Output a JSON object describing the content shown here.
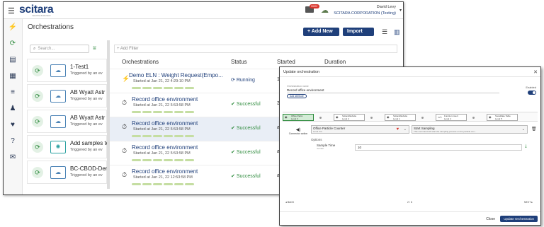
{
  "app": {
    "logo_main": "scitara",
    "tagline": "meet the dexterous!",
    "notif_count": "9999+",
    "user_name": "David Levy",
    "user_company": "SCITARA CORPORATION (Testing)"
  },
  "page": {
    "title": "Orchestrations",
    "add_new": "+ Add New",
    "import": "Import"
  },
  "left": {
    "search_placeholder": "Search...",
    "cards": [
      {
        "title": "1-Test1",
        "sub": "Triggered by an ev"
      },
      {
        "title": "AB Wyatt Astr",
        "sub": "Triggered by an ev"
      },
      {
        "title": "AB Wyatt Astr",
        "sub": "Triggered by an ev"
      },
      {
        "title": "Add samples tc",
        "sub": "Triggered by an ev"
      },
      {
        "title": "BC-CBOD-Den",
        "sub": "Triggered by an ev"
      }
    ]
  },
  "table": {
    "add_filter": "+ Add Filter",
    "headers": {
      "orchestrations": "Orchestrations",
      "status": "Status",
      "started": "Started",
      "duration": "Duration"
    },
    "rows": [
      {
        "name": "Demo ELN : Weight Request(Empo...",
        "started": "Started at Jan 21, 22 4:29:10 PM",
        "status": "Running",
        "by": "1"
      },
      {
        "name": "Record office environment",
        "started": "Started at Jan 21, 22 5:53:58 PM",
        "status": "Successful",
        "by": "3e"
      },
      {
        "name": "Record office environment",
        "started": "Started at Jan 21, 22 5:53:58 PM",
        "status": "Successful",
        "by": "ab"
      },
      {
        "name": "Record office environment",
        "started": "Started at Jan 21, 22 5:53:58 PM",
        "status": "Successful",
        "by": "ab"
      },
      {
        "name": "Record office environment",
        "started": "Started at Jan 21, 22 12:53:58 PM",
        "status": "Successful",
        "by": "ab"
      }
    ]
  },
  "dialog": {
    "title": "Update orchestration",
    "name_label": "Orchestration name",
    "name_value": "Record office environment",
    "add_attr": "Add attribute",
    "enabled": "Enabled",
    "steps": [
      {
        "t": "Office Partic.",
        "s": "Level 3"
      },
      {
        "t": "ScitaraWebsite",
        "s": "Level 2"
      },
      {
        "t": "ScitaraWebsite",
        "s": "Level 1"
      },
      {
        "t": "Function insert",
        "s": "Level 4"
      },
      {
        "t": "Snowflake Table",
        "s": "Level 5"
      }
    ],
    "connector_label": "Connector action",
    "connector_name": "Office Particle Counter",
    "connector_sub": "Level 3 D",
    "action_name": "Start Sampling",
    "action_sub": "This command will start the sampling process on the particle cou...",
    "options": "Options",
    "sample_time_label": "Sample Time",
    "sample_time_sub": "number",
    "sample_time_value": "10",
    "back": "BACK",
    "page": "2 / 6",
    "next": "NEXT",
    "close": "Close",
    "update": "Update Orchestration"
  },
  "colors": {
    "brand": "#1f3f7a",
    "accent": "#e6a228",
    "success": "#2e8b3d",
    "badge": "#d9342b"
  }
}
